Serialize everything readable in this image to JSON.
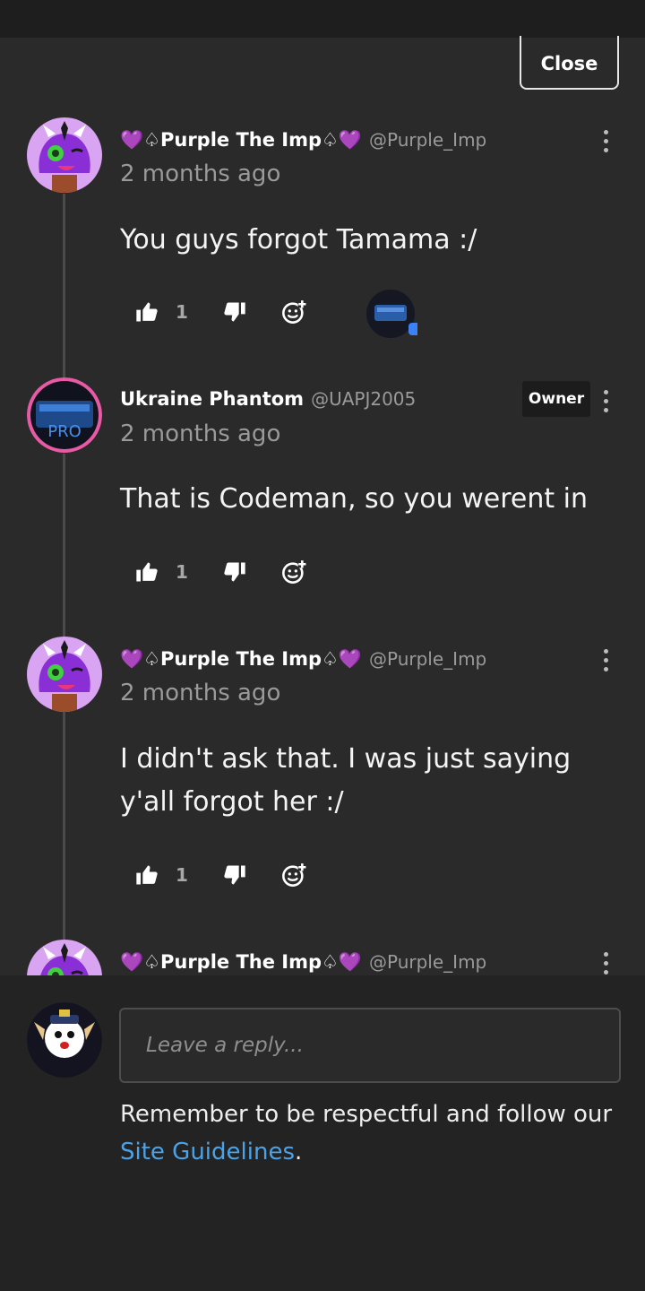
{
  "header": {
    "close_label": "Close"
  },
  "comments": [
    {
      "author": "💜♤Purple The Imp♤💜",
      "handle": "@Purple_Imp",
      "time": "2 months ago",
      "text": "You guys forgot Tamama :/",
      "likes": "1",
      "has_reaction_avatar": true
    },
    {
      "author": "Ukraine Phantom",
      "handle": "@UAPJ2005",
      "time": "2 months ago",
      "badge": "Owner",
      "text": "That is Codeman, so you werent in",
      "likes": "1"
    },
    {
      "author": "💜♤Purple The Imp♤💜",
      "handle": "@Purple_Imp",
      "time": "2 months ago",
      "text": "I didn't ask that. I was just saying y'all forgot her :/",
      "likes": "1"
    },
    {
      "author": "💜♤Purple The Imp♤💜",
      "handle": "@Purple_Imp"
    }
  ],
  "composer": {
    "placeholder": "Leave a reply...",
    "notice_prefix": "Remember to be respectful and follow our ",
    "link_text": "Site Guidelines",
    "notice_suffix": "."
  },
  "icons": [
    "more-vert-icon",
    "thumbs-up-icon",
    "thumbs-down-icon",
    "add-reaction-icon"
  ],
  "colors": {
    "background": "#2b2a2a",
    "link": "#4aa3e8",
    "secondary_text": "#9a9a9a"
  }
}
